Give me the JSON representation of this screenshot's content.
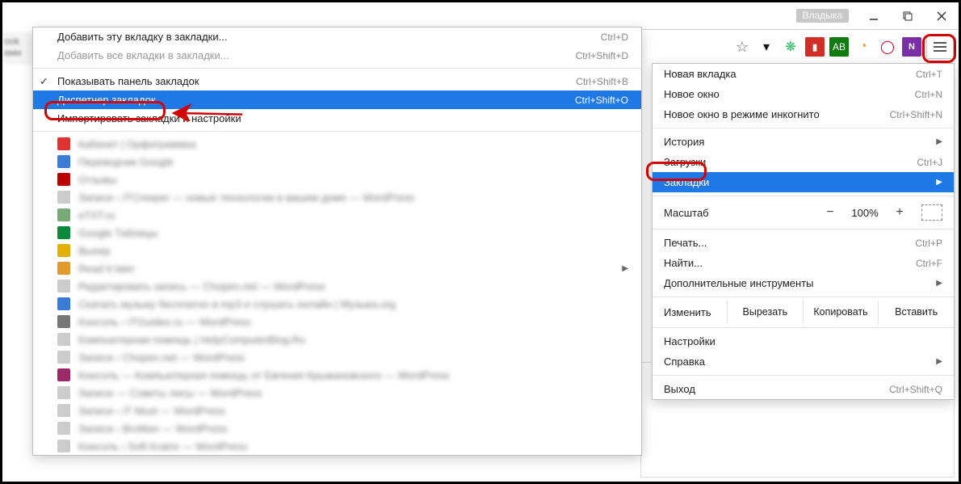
{
  "chrome": {
    "user_badge": "Владыка",
    "star_title": "Добавить в закладки"
  },
  "submenu": {
    "add_page": "Добавить эту вкладку в закладки...",
    "add_page_sc": "Ctrl+D",
    "add_all": "Добавить все вкладки в закладки...",
    "add_all_sc": "Ctrl+Shift+D",
    "show_bar": "Показывать панель закладок",
    "show_bar_sc": "Ctrl+Shift+B",
    "manager": "Диспетчер закладок",
    "manager_sc": "Ctrl+Shift+O",
    "import": "Импортировать закладки и настройки"
  },
  "bookmarks": [
    {
      "color": "#d33",
      "text": "Кабинет | Орфограммка"
    },
    {
      "color": "#3a7bd5",
      "text": "Переводчик Google"
    },
    {
      "color": "#b00",
      "text": "Отзывы"
    },
    {
      "color": "#ccc",
      "text": "Записи ‹ ITCreeper — новые технологии в вашем доме — WordPress"
    },
    {
      "color": "#7a7",
      "text": "eTXT.ru"
    },
    {
      "color": "#0a8a3a",
      "text": "Google Таблицы"
    },
    {
      "color": "#e1b000",
      "text": "Вьюер"
    },
    {
      "color": "#e29a2c",
      "text": "Read it later",
      "submenu": true
    },
    {
      "color": "#ccc",
      "text": "Редактировать запись — Chopen.net — WordPress"
    },
    {
      "color": "#3a7bd5",
      "text": "Скачать музыку бесплатно в mp3 и слушать онлайн | Музыка.org"
    },
    {
      "color": "#777",
      "text": "Консоль ‹ ITGuides.ru — WordPress"
    },
    {
      "color": "#ccc",
      "text": "Компьютерная помощь | HelpComputerBlog.Ru"
    },
    {
      "color": "#ccc",
      "text": "Записи ‹ Chopen.net — WordPress"
    },
    {
      "color": "#9c2a6b",
      "text": "Консоль — Компьютерная помощь от Евгения Крыжановского — WordPress"
    },
    {
      "color": "#ccc",
      "text": "Записи — Советы лисы — WordPress"
    },
    {
      "color": "#ccc",
      "text": "Записи ‹ IT Must — WordPress"
    },
    {
      "color": "#ccc",
      "text": "Записи ‹ BroMan — WordPress"
    },
    {
      "color": "#ccc",
      "text": "Консоль ‹ Soft Krains — WordPress"
    }
  ],
  "menu": {
    "new_tab": "Новая вкладка",
    "new_tab_sc": "Ctrl+T",
    "new_win": "Новое окно",
    "new_win_sc": "Ctrl+N",
    "incognito": "Новое окно в режиме инкогнито",
    "incognito_sc": "Ctrl+Shift+N",
    "history": "История",
    "downloads": "Загрузки",
    "downloads_sc": "Ctrl+J",
    "bookmarks": "Закладки",
    "zoom_label": "Масштаб",
    "zoom_value": "100%",
    "print": "Печать...",
    "print_sc": "Ctrl+P",
    "find": "Найти...",
    "find_sc": "Ctrl+F",
    "more_tools": "Дополнительные инструменты",
    "edit": "Изменить",
    "cut": "Вырезать",
    "copy": "Копировать",
    "paste": "Вставить",
    "settings": "Настройки",
    "help": "Справка",
    "exit": "Выход",
    "exit_sc": "Ctrl+Shift+Q"
  }
}
